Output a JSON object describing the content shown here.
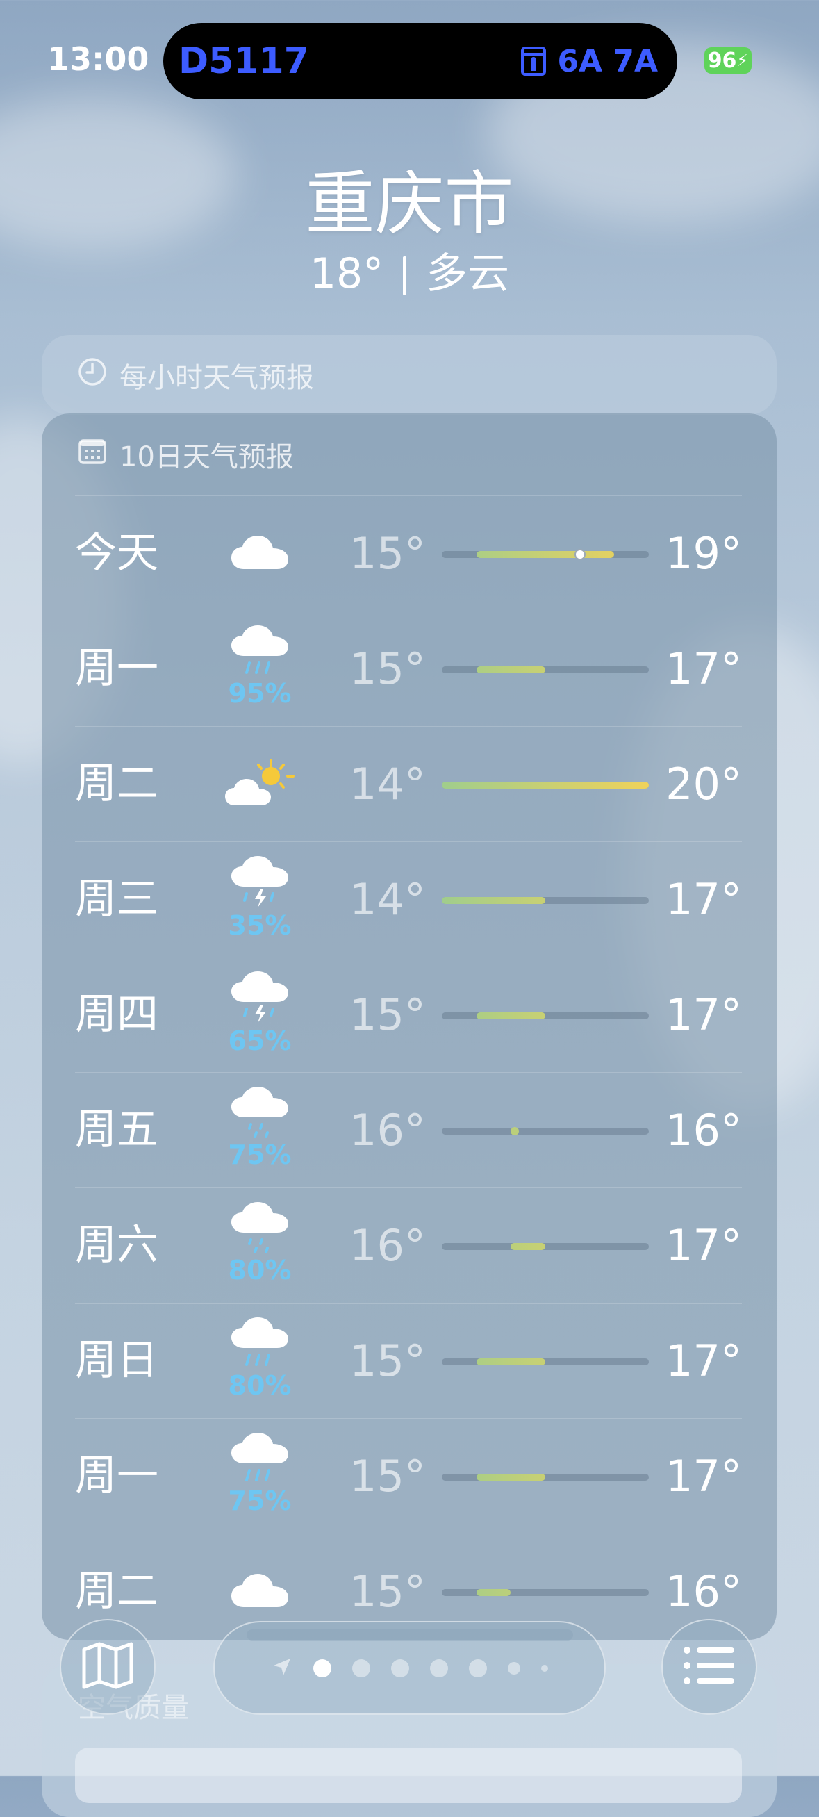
{
  "status": {
    "time": "13:00",
    "battery": "96"
  },
  "island": {
    "left_text": "D5117",
    "right_text": "6A 7A"
  },
  "header": {
    "city": "重庆市",
    "temp": "18°",
    "condition": "多云"
  },
  "hourly": {
    "label": "每小时天气预报"
  },
  "forecast": {
    "label": "10日天气预报",
    "range_min": 14,
    "range_max": 20,
    "current_temp": 18,
    "days": [
      {
        "day": "今天",
        "icon": "cloud-icon",
        "pop": "",
        "low": "15°",
        "high": "19°",
        "lo_val": 15,
        "hi_val": 19
      },
      {
        "day": "周一",
        "icon": "rain-icon",
        "pop": "95%",
        "low": "15°",
        "high": "17°",
        "lo_val": 15,
        "hi_val": 17
      },
      {
        "day": "周二",
        "icon": "partly-sunny-icon",
        "pop": "",
        "low": "14°",
        "high": "20°",
        "lo_val": 14,
        "hi_val": 20
      },
      {
        "day": "周三",
        "icon": "thunderstorm-icon",
        "pop": "35%",
        "low": "14°",
        "high": "17°",
        "lo_val": 14,
        "hi_val": 17
      },
      {
        "day": "周四",
        "icon": "thunderstorm-icon",
        "pop": "65%",
        "low": "15°",
        "high": "17°",
        "lo_val": 15,
        "hi_val": 17
      },
      {
        "day": "周五",
        "icon": "drizzle-icon",
        "pop": "75%",
        "low": "16°",
        "high": "16°",
        "lo_val": 16,
        "hi_val": 16
      },
      {
        "day": "周六",
        "icon": "drizzle-icon",
        "pop": "80%",
        "low": "16°",
        "high": "17°",
        "lo_val": 16,
        "hi_val": 17
      },
      {
        "day": "周日",
        "icon": "rain-icon",
        "pop": "80%",
        "low": "15°",
        "high": "17°",
        "lo_val": 15,
        "hi_val": 17
      },
      {
        "day": "周一",
        "icon": "rain-icon",
        "pop": "75%",
        "low": "15°",
        "high": "17°",
        "lo_val": 15,
        "hi_val": 17
      },
      {
        "day": "周二",
        "icon": "cloud-icon",
        "pop": "",
        "low": "15°",
        "high": "16°",
        "lo_val": 15,
        "hi_val": 16
      }
    ]
  },
  "air_quality": {
    "label": "空气质量"
  },
  "toolbar": {
    "map_icon": "map-icon",
    "list_icon": "list-icon",
    "pages": 7,
    "active_page": 1
  }
}
